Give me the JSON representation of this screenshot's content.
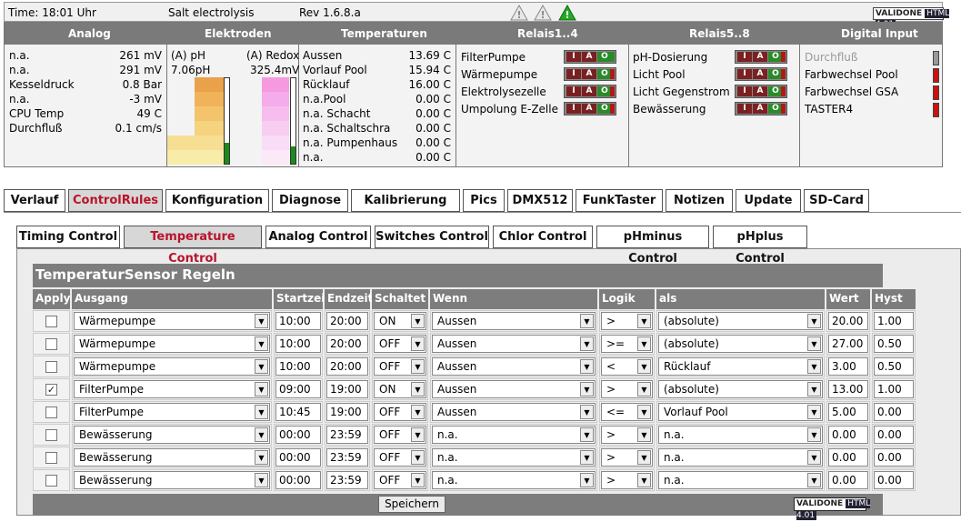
{
  "topbar": {
    "time": "Time: 18:01 Uhr",
    "title": "Salt electrolysis",
    "rev": "Rev 1.6.8.a",
    "warning_icons": [
      "warning-grey-icon",
      "warning-grey-icon",
      "warning-green-icon"
    ],
    "valid_badge": "HTML 4.01",
    "valid_logo": "VALIDONE"
  },
  "status": {
    "headers": [
      "Analog",
      "Elektroden",
      "Temperaturen",
      "Relais1..4",
      "Relais5..8",
      "Digital Input"
    ],
    "analog": [
      {
        "label": "n.a.",
        "value": "261 mV"
      },
      {
        "label": "n.a.",
        "value": "291 mV"
      },
      {
        "label": "Kesseldruck",
        "value": "0.8 Bar"
      },
      {
        "label": "n.a.",
        "value": "-3 mV"
      },
      {
        "label": "CPU Temp",
        "value": "49 C"
      },
      {
        "label": "Durchfluß",
        "value": "0.1 cm/s"
      }
    ],
    "elektroden": {
      "ph_label": "(A) pH",
      "redox_label": "(A) Redox",
      "ph_value": "7.06pH",
      "redox_value": "325.4mV",
      "ph_level": 0.25,
      "redox_level": 0.2
    },
    "temperaturen": [
      {
        "label": "Aussen",
        "value": "13.69 C"
      },
      {
        "label": "Vorlauf Pool",
        "value": "15.94 C"
      },
      {
        "label": "Rücklauf",
        "value": "16.00 C"
      },
      {
        "label": "n.a.Pool",
        "value": "0.00 C"
      },
      {
        "label": "n.a. Schacht",
        "value": "0.00 C"
      },
      {
        "label": "n.a. Schaltschra",
        "value": "0.00 C"
      },
      {
        "label": "n.a. Pumpenhaus",
        "value": "0.00 C"
      },
      {
        "label": "n.a.",
        "value": "0.00 C"
      }
    ],
    "relay_letters": [
      "I",
      "A",
      "O"
    ],
    "relais1": [
      {
        "label": "FilterPumpe",
        "on": true
      },
      {
        "label": "Wärmepumpe",
        "on": false
      },
      {
        "label": "Elektrolysezelle",
        "on": false
      },
      {
        "label": "Umpolung E-Zelle",
        "on": false
      }
    ],
    "relais5": [
      {
        "label": "pH-Dosierung",
        "on": false
      },
      {
        "label": "Licht Pool",
        "on": false
      },
      {
        "label": "Licht Gegenstrom",
        "on": false
      },
      {
        "label": "Bewässerung",
        "on": false
      }
    ],
    "digital": [
      {
        "label": "Durchfluß",
        "disabled": true
      },
      {
        "label": "Farbwechsel Pool",
        "disabled": false
      },
      {
        "label": "Farbwechsel GSA",
        "disabled": false
      },
      {
        "label": "TASTER4",
        "disabled": false
      }
    ],
    "colors": {
      "relay_on": "#2a8a2a",
      "relay_off": "#b01818",
      "din_off": "#cc1111",
      "din_disabled": "#999999"
    }
  },
  "tabs": [
    "Verlauf",
    "ControlRules",
    "Konfiguration",
    "Diagnose",
    "Kalibrierung",
    "Pics",
    "DMX512",
    "FunkTaster",
    "Notizen",
    "Update",
    "SD-Card"
  ],
  "active_tab": "ControlRules",
  "subtabs": [
    "Timing Control",
    "Temperature Control",
    "Analog Control",
    "Switches Control",
    "Chlor Control",
    "pHminus Control",
    "pHplus Control"
  ],
  "active_subtab": "Temperature Control",
  "rules": {
    "title": "TemperaturSensor Regeln",
    "columns": [
      "Apply",
      "Ausgang",
      "Startzeit",
      "Endzeit",
      "Schaltet",
      "Wenn",
      "Logik",
      "als",
      "Wert",
      "Hyst"
    ],
    "rows": [
      {
        "apply": false,
        "ausgang": "Wärmepumpe",
        "start": "10:00",
        "end": "20:00",
        "schaltet": "ON",
        "wenn": "Aussen",
        "logik": ">",
        "als": "(absolute)",
        "wert": "20.00",
        "hyst": "1.00"
      },
      {
        "apply": false,
        "ausgang": "Wärmepumpe",
        "start": "10:00",
        "end": "20:00",
        "schaltet": "OFF",
        "wenn": "Aussen",
        "logik": ">=",
        "als": "(absolute)",
        "wert": "27.00",
        "hyst": "0.50"
      },
      {
        "apply": false,
        "ausgang": "Wärmepumpe",
        "start": "10:00",
        "end": "20:00",
        "schaltet": "OFF",
        "wenn": "Aussen",
        "logik": "<",
        "als": "Rücklauf",
        "wert": "3.00",
        "hyst": "0.50"
      },
      {
        "apply": true,
        "ausgang": "FilterPumpe",
        "start": "09:00",
        "end": "19:00",
        "schaltet": "ON",
        "wenn": "Aussen",
        "logik": ">",
        "als": "(absolute)",
        "wert": "13.00",
        "hyst": "1.00"
      },
      {
        "apply": false,
        "ausgang": "FilterPumpe",
        "start": "10:45",
        "end": "19:00",
        "schaltet": "OFF",
        "wenn": "Aussen",
        "logik": "<=",
        "als": "Vorlauf Pool",
        "wert": "5.00",
        "hyst": "0.00"
      },
      {
        "apply": false,
        "ausgang": "Bewässerung",
        "start": "00:00",
        "end": "23:59",
        "schaltet": "OFF",
        "wenn": "n.a.",
        "logik": ">",
        "als": "n.a.",
        "wert": "0.00",
        "hyst": "0.00"
      },
      {
        "apply": false,
        "ausgang": "Bewässerung",
        "start": "00:00",
        "end": "23:59",
        "schaltet": "OFF",
        "wenn": "n.a.",
        "logik": ">",
        "als": "n.a.",
        "wert": "0.00",
        "hyst": "0.00"
      },
      {
        "apply": false,
        "ausgang": "Bewässerung",
        "start": "00:00",
        "end": "23:59",
        "schaltet": "OFF",
        "wenn": "n.a.",
        "logik": ">",
        "als": "n.a.",
        "wert": "0.00",
        "hyst": "0.00"
      }
    ],
    "save_label": "Speichern"
  }
}
